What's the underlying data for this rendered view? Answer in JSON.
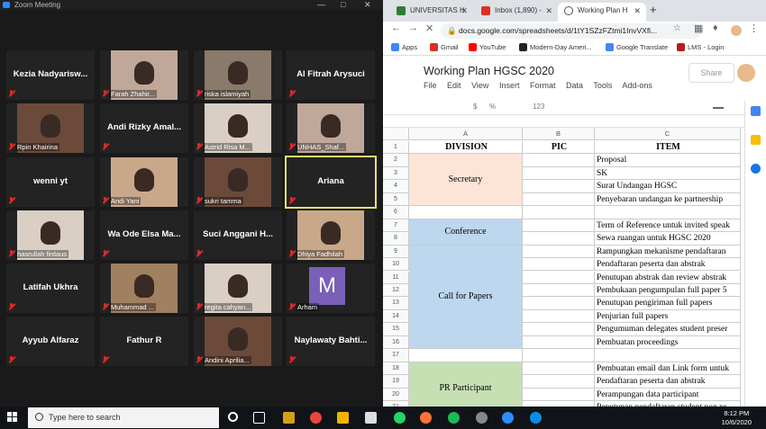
{
  "zoom": {
    "window_title": "Zoom Meeting",
    "participants": [
      {
        "name": "Kezia  Nadyarisw...",
        "kind": "name"
      },
      {
        "name": "Farah Zhahir...",
        "kind": "video"
      },
      {
        "name": "riska islamiyah",
        "kind": "video"
      },
      {
        "name": "Al Fitrah Arysuci",
        "kind": "name"
      },
      {
        "name": "Rpin Khairina",
        "kind": "video"
      },
      {
        "name": "Andi Rizky  Amal...",
        "kind": "name"
      },
      {
        "name": "Astrid Risa M...",
        "kind": "video"
      },
      {
        "name": "UNHAS_Shaf...",
        "kind": "video"
      },
      {
        "name": "wenni yt",
        "kind": "name"
      },
      {
        "name": "Andi Yani",
        "kind": "video"
      },
      {
        "name": "sukri tamma",
        "kind": "video"
      },
      {
        "name": "Ariana",
        "kind": "name",
        "active": true
      },
      {
        "name": "hasrullah firdaus",
        "kind": "video"
      },
      {
        "name": "Wa Ode Elsa Ma...",
        "kind": "name"
      },
      {
        "name": "Suci Anggani H...",
        "kind": "name"
      },
      {
        "name": "Dhiya Fadhilah",
        "kind": "video"
      },
      {
        "name": "Latifah Ukhra",
        "kind": "name"
      },
      {
        "name": "Muhammad ...",
        "kind": "video"
      },
      {
        "name": "regita cahyan...",
        "kind": "video"
      },
      {
        "name": "Arham",
        "kind": "avatar",
        "avatar_letter": "M"
      },
      {
        "name": "Ayyub Alfaraz",
        "kind": "name"
      },
      {
        "name": "Fathur R",
        "kind": "name"
      },
      {
        "name": "Andini Aprilia...",
        "kind": "video"
      },
      {
        "name": "Naylawaty  Bahti...",
        "kind": "name"
      }
    ]
  },
  "browser": {
    "tabs": [
      {
        "label": "UNIVERSITAS H",
        "favicon_color": "#2e7d32"
      },
      {
        "label": "Inbox (1,890) - ",
        "favicon_color": "#d93025"
      },
      {
        "label": "Working Plan H",
        "favicon_color": "#555555",
        "active": true
      }
    ],
    "new_tab": "+",
    "url": "docs.google.com/spreadsheets/d/1tY1SZzFZtmi1InvVXfi...",
    "bookmarks": [
      {
        "label": "Apps",
        "color": "#4285f4"
      },
      {
        "label": "Gmail",
        "color": "#d93025"
      },
      {
        "label": "YouTube",
        "color": "#ff0000"
      },
      {
        "label": "Modern-Day Ameri...",
        "color": "#222222"
      },
      {
        "label": "Google Translate",
        "color": "#4285f4"
      },
      {
        "label": "LMS - Login",
        "color": "#b71c1c"
      }
    ]
  },
  "sheet": {
    "title": "Working Plan HGSC 2020",
    "menus": [
      "File",
      "Edit",
      "View",
      "Insert",
      "Format",
      "Data",
      "Tools",
      "Add-ons"
    ],
    "share_label": "Share",
    "toolbar_items": [
      "$",
      "%",
      "123"
    ],
    "columns": [
      "A",
      "B",
      "C"
    ],
    "headers": {
      "division": "DIVISION",
      "pic": "PIC",
      "item": "ITEM"
    },
    "rows": [
      {
        "n": "2",
        "item": "Proposal"
      },
      {
        "n": "3",
        "item": "SK"
      },
      {
        "n": "4",
        "item": "Surat Undangan HGSC"
      },
      {
        "n": "5",
        "item": "Penyebaran undangan ke partnership"
      },
      {
        "n": "6",
        "item": ""
      },
      {
        "n": "7",
        "item": "Term of Reference untuk invited speak"
      },
      {
        "n": "8",
        "item": "Sewa ruangan untuk HGSC 2020"
      },
      {
        "n": "9",
        "item": "Rampungkan mekanisme pendaftaran"
      },
      {
        "n": "10",
        "item": "Pendaftaran peserta dan abstrak"
      },
      {
        "n": "11",
        "item": "Penutupan abstrak dan review abstrak"
      },
      {
        "n": "12",
        "item": "Pembukaan pengumpulan full paper 5"
      },
      {
        "n": "13",
        "item": "Penutupan pengiriman full papers"
      },
      {
        "n": "14",
        "item": "Penjurian full papers"
      },
      {
        "n": "15",
        "item": "Pengumuman delegates student preser"
      },
      {
        "n": "16",
        "item": "Pembuatan proceedings"
      },
      {
        "n": "17",
        "item": ""
      },
      {
        "n": "18",
        "item": "Pembuatan email dan Link form untuk"
      },
      {
        "n": "19",
        "item": "Pendaftaran peserta dan abstrak"
      },
      {
        "n": "20",
        "item": "Perampungan data participant"
      },
      {
        "n": "21",
        "item": "Penutupan pendaftaran student non pr"
      }
    ],
    "divisions": [
      {
        "label": "Secretary",
        "color": "#fce5d6"
      },
      {
        "label": "Conference",
        "color": "#bdd7ee"
      },
      {
        "label": "Call for Papers",
        "color": "#bdd7ee"
      },
      {
        "label": "PR Participant",
        "color": "#c6e0b4"
      }
    ]
  },
  "taskbar": {
    "search_placeholder": "Type here to search",
    "time": "8:12 PM",
    "date": "10/6/2020"
  }
}
